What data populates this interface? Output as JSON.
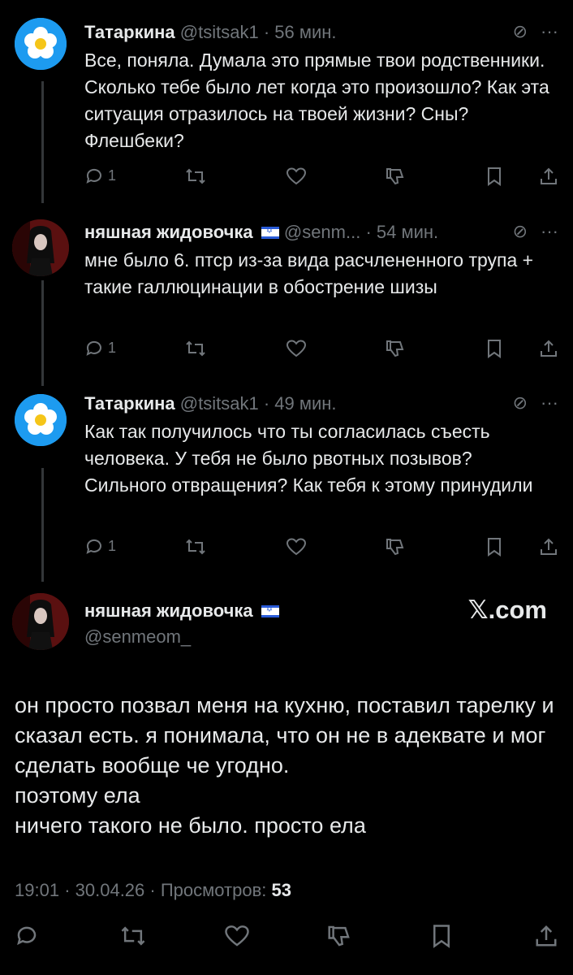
{
  "tweets": [
    {
      "name": "Татаркина",
      "handle": "@tsitsak1",
      "time": "56 мин.",
      "text": "Все, поняла. Думала это прямые твои родственники. Сколько тебе было лет когда это произошло? Как эта ситуация отразилось на твоей жизни? Сны? Флешбеки?",
      "reply_count": "1",
      "avatar": "flower-avatar"
    },
    {
      "name": "няшная жидовочка",
      "handle": "@senm...",
      "time": "54 мин.",
      "text": "мне было 6. птср из-за вида расчлененного трупа + такие галлюцинации в обострение шизы",
      "reply_count": "1",
      "avatar": "goth-girl-avatar"
    },
    {
      "name": "Татаркина",
      "handle": "@tsitsak1",
      "time": "49 мин.",
      "text": "Как так получилось что ты согласилась съесть человека. У тебя не было рвотных позывов? Сильного отвращения? Как тебя к этому принудили",
      "reply_count": "1",
      "avatar": "flower-avatar"
    }
  ],
  "main_tweet": {
    "name": "няшная жидовочка",
    "handle": "@senmeom_",
    "brand": "𝕏.com",
    "text": "он просто позвал меня на кухню, поставил тарелку и сказал есть. я понимала, что он не в адеквате и мог сделать вообще че угодно.\nпоэтому ела\nничего такого не было. просто ела",
    "time": "19:01",
    "date": "30.04.26",
    "views_label": "Просмотров:",
    "views": "53"
  },
  "separator": "·",
  "colors": {
    "background": "#000000",
    "text": "#e7e9ea",
    "muted": "#71767b",
    "avatar_blue": "#1d9bf0"
  }
}
